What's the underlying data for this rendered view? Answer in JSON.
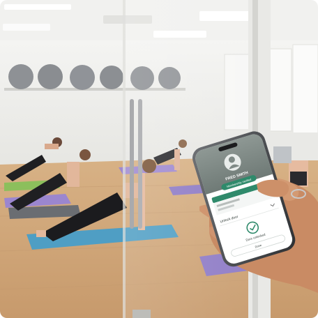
{
  "phone_screen": {
    "member_name": "FRED SMITH",
    "verify_button": "Membership Verified",
    "section_label": "Unlock door",
    "status_text": "Door unlocked",
    "bottom_button": "Done"
  },
  "colors": {
    "accent_green": "#2f8a6b",
    "mat_blue": "#4f9ec4",
    "mat_purple": "#8e7bc6",
    "floor_wood": "#d9b48a",
    "wall": "#eeeeea"
  },
  "icons": [
    "person-avatar-icon",
    "edit-pencil-icon",
    "check-circle-icon",
    "chevron-down-icon"
  ]
}
